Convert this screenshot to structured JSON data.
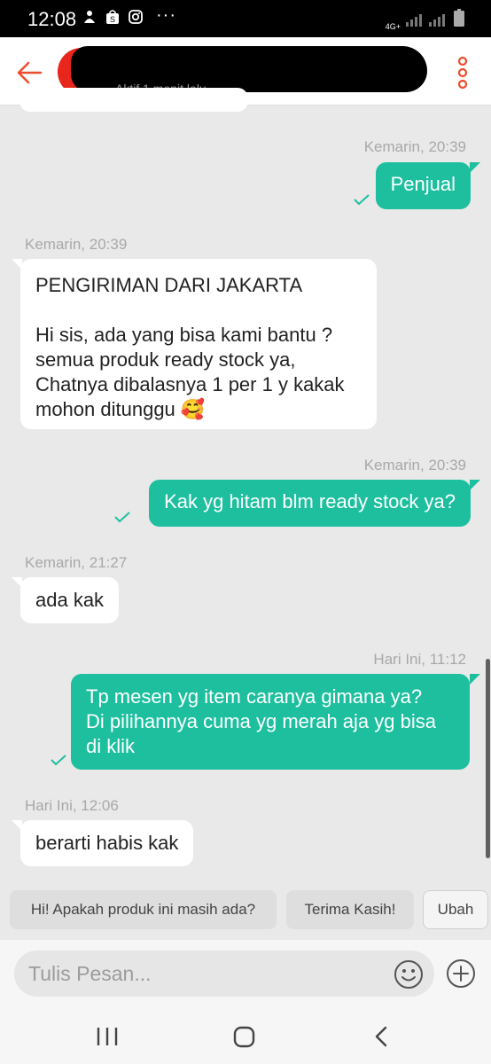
{
  "status_bar": {
    "time": "12:08",
    "network_label": "4G+",
    "icons": [
      "notification-icon",
      "shopee-icon",
      "instagram-icon",
      "more-icon",
      "signal-icon",
      "battery-icon"
    ]
  },
  "header": {
    "subtitle": "Aktif 1 menit lalu",
    "accent_color": "#ee4d2d"
  },
  "messages": [
    {
      "side": "out",
      "time": "Kemarin, 20:39",
      "lines": [
        "Penjual"
      ]
    },
    {
      "side": "in",
      "time": "Kemarin, 20:39",
      "lines": [
        "PENGIRIMAN DARI JAKARTA",
        "",
        "Hi sis, ada yang bisa kami bantu ?",
        "semua produk ready stock ya,",
        "Chatnya dibalasnya 1 per 1  y kakak",
        "mohon ditunggu 🥰"
      ]
    },
    {
      "side": "out",
      "time": "Kemarin, 20:39",
      "lines": [
        "Kak yg hitam blm ready stock ya?"
      ]
    },
    {
      "side": "in",
      "time": "Kemarin, 21:27",
      "lines": [
        "ada kak"
      ]
    },
    {
      "side": "out",
      "time": "Hari Ini, 11:12",
      "lines": [
        "Tp mesen yg item caranya gimana ya?",
        "Di pilihannya cuma yg merah aja yg bisa",
        "di klik"
      ]
    },
    {
      "side": "in",
      "time": "Hari Ini, 12:06",
      "lines": [
        "berarti habis kak"
      ]
    }
  ],
  "quick_replies": [
    "Hi! Apakah produk ini masih ada?",
    "Terima Kasih!",
    "Ubah"
  ],
  "input": {
    "placeholder": "Tulis Pesan..."
  },
  "colors": {
    "outgoing_bubble": "#1dbf9f",
    "incoming_bubble": "#ffffff",
    "background": "#e9e9e9"
  }
}
